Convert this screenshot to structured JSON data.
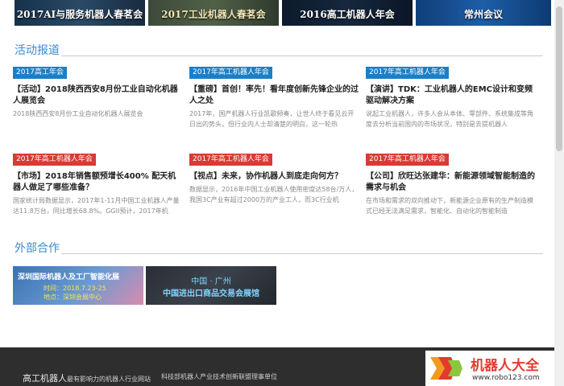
{
  "banners": [
    {
      "label": "2017AI与服务机器人春茗会"
    },
    {
      "label": "2017工业机器人春茗会"
    },
    {
      "label": "2016高工机器人年会"
    },
    {
      "label": "常州会议"
    }
  ],
  "news": {
    "title": "活动报道",
    "items": [
      {
        "tag": "2017高工年会",
        "tag_color": "#1b7fc8",
        "title": "【活动】2018陕西西安8月份工业自动化机器人展览会",
        "desc": "2018陕西西安8月份工业自动化机器人展览会"
      },
      {
        "tag": "2017年高工机器人年会",
        "tag_color": "#1b7fc8",
        "title": "【重磅】首创！率先！看年度创新先锋企业的过人之处",
        "desc": "2017年，国产机器人行业凯歌频奏，让世人终于看见云开日出的势头，但行业内人士却清楚的明白，这一轮热"
      },
      {
        "tag": "2017年高工机器人年会",
        "tag_color": "#1b7fc8",
        "title": "【演讲】TDK：工业机器人的EMC设计和变频驱动解决方案",
        "desc": "说起工业机器人，许多人会从本体、零部件、系统集成等角度去分析当前国内的市场状况，特别是去提机器人"
      },
      {
        "tag": "2017年高工机器人年会",
        "tag_color": "#d83a34",
        "title": "【市场】2018年销售额预增长400% 配天机器人做足了哪些准备？",
        "desc": "国家统计局数据显示，2017年1-11月中国工业机器人产量达11.8万台，同比增长68.8%。GGII预计，2017年机"
      },
      {
        "tag": "2017年高工机器人年会",
        "tag_color": "#d83a34",
        "title": "【视点】未来，协作机器人到底走向何方？",
        "desc": "数据显示，2016年中国工业机器人使用密度达58台/万人，我国3C产业有超过2000万的产业工人，而3C行业机"
      },
      {
        "tag": "2017年高工机器人年会",
        "tag_color": "#d83a34",
        "title": "【公司】欣旺达张建华：新能源领域智能制造的需求与机会",
        "desc": "在市场和需求的双向推动下，新能源企业原有的生产制造模式已经无法满足需求，智能化、自动化的智能制造"
      }
    ]
  },
  "partners": {
    "title": "外部合作",
    "items": [
      {
        "line1": "深圳国际机器人及工厂智能化展",
        "line2": "时间：2018.7.23-25",
        "line3": "地点：深圳会展中心"
      },
      {
        "line1": "中国 · 广州",
        "line2": "中国进出口商品交易会展馆"
      }
    ]
  },
  "footer": {
    "brand_name": "高工机器人",
    "brand_slogan": "最有影响力的机器人行业网站",
    "member": "科技部机器人产业技术创新联盟理事单位"
  },
  "watermark": {
    "name": "机器人大全",
    "url": "www.robo123.com"
  },
  "colors": {
    "accent_blue": "#3a8ad4",
    "tag_red": "#d83a34",
    "tag_blue": "#1b7fc8",
    "footer_bg": "#2e2e2e"
  }
}
